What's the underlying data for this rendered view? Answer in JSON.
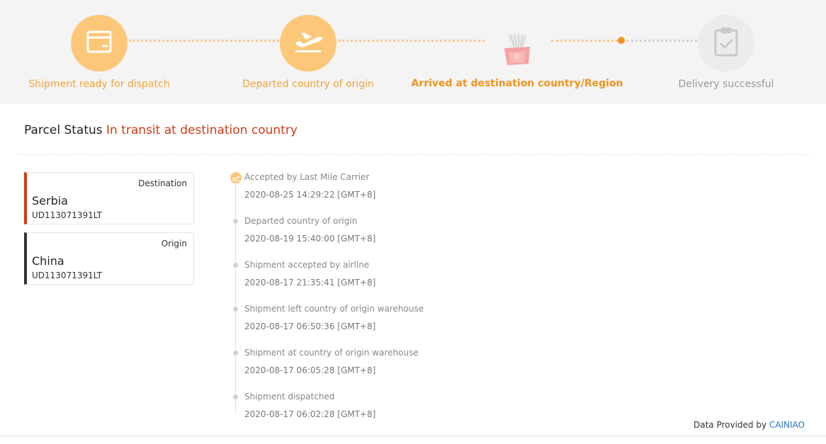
{
  "steps": [
    {
      "label": "Shipment ready for dispatch",
      "state": "done",
      "icon": "box-icon"
    },
    {
      "label": "Departed country of origin",
      "state": "done",
      "icon": "plane-takeoff-icon"
    },
    {
      "label": "Arrived at destination country/Region",
      "state": "current",
      "icon": "arrival-image"
    },
    {
      "label": "Delivery successful",
      "state": "pending",
      "icon": "clipboard-check-icon"
    }
  ],
  "status": {
    "label": "Parcel Status",
    "value": "In transit at destination country"
  },
  "cards": {
    "destination": {
      "role": "Destination",
      "country": "Serbia",
      "tracking": "UD113071391LT"
    },
    "origin": {
      "role": "Origin",
      "country": "China",
      "tracking": "UD113071391LT"
    }
  },
  "timeline": [
    {
      "event": "Accepted by Last Mile Carrier",
      "time": "2020-08-25 14:29:22 [GMT+8]"
    },
    {
      "event": "Departed country of origin",
      "time": "2020-08-19 15:40:00 [GMT+8]"
    },
    {
      "event": "Shipment accepted by airline",
      "time": "2020-08-17 21:35:41 [GMT+8]"
    },
    {
      "event": "Shipment left country of origin warehouse",
      "time": "2020-08-17 06:50:36 [GMT+8]"
    },
    {
      "event": "Shipment at country of origin warehouse",
      "time": "2020-08-17 06:05:28 [GMT+8]"
    },
    {
      "event": "Shipment dispatched",
      "time": "2020-08-17 06:02:28 [GMT+8]"
    }
  ],
  "footer": {
    "prefix": "Data Provided by",
    "provider": "CAINIAO"
  },
  "colors": {
    "accent": "#f19420",
    "done_circle": "#fcc778",
    "status_red": "#d23a12",
    "link_blue": "#2a73c4"
  }
}
